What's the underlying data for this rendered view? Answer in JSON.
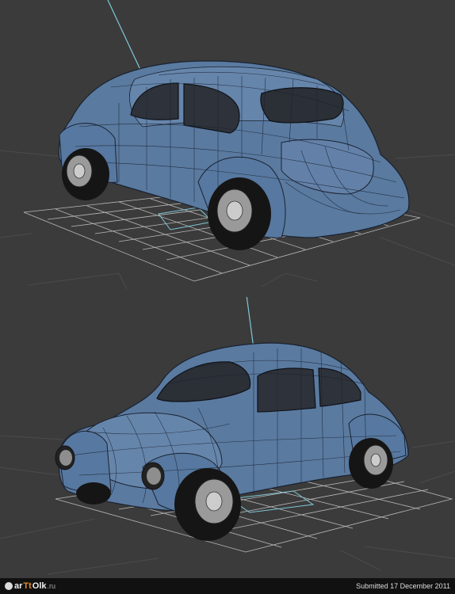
{
  "footer": {
    "logo_prefix": "ar",
    "logo_accent": "Tt",
    "logo_suffix": "Olk",
    "logo_tld": ".ru",
    "submitted_text": "Submitted 17 December 2011"
  },
  "colors": {
    "background": "#3b3b3b",
    "car_body": "#5a7aa0",
    "wire": "#1a2230",
    "grid": "#cfcfcf",
    "gizmo": "#7ec8d8"
  },
  "views": [
    {
      "name": "rear-three-quarter-view"
    },
    {
      "name": "front-three-quarter-view"
    }
  ]
}
